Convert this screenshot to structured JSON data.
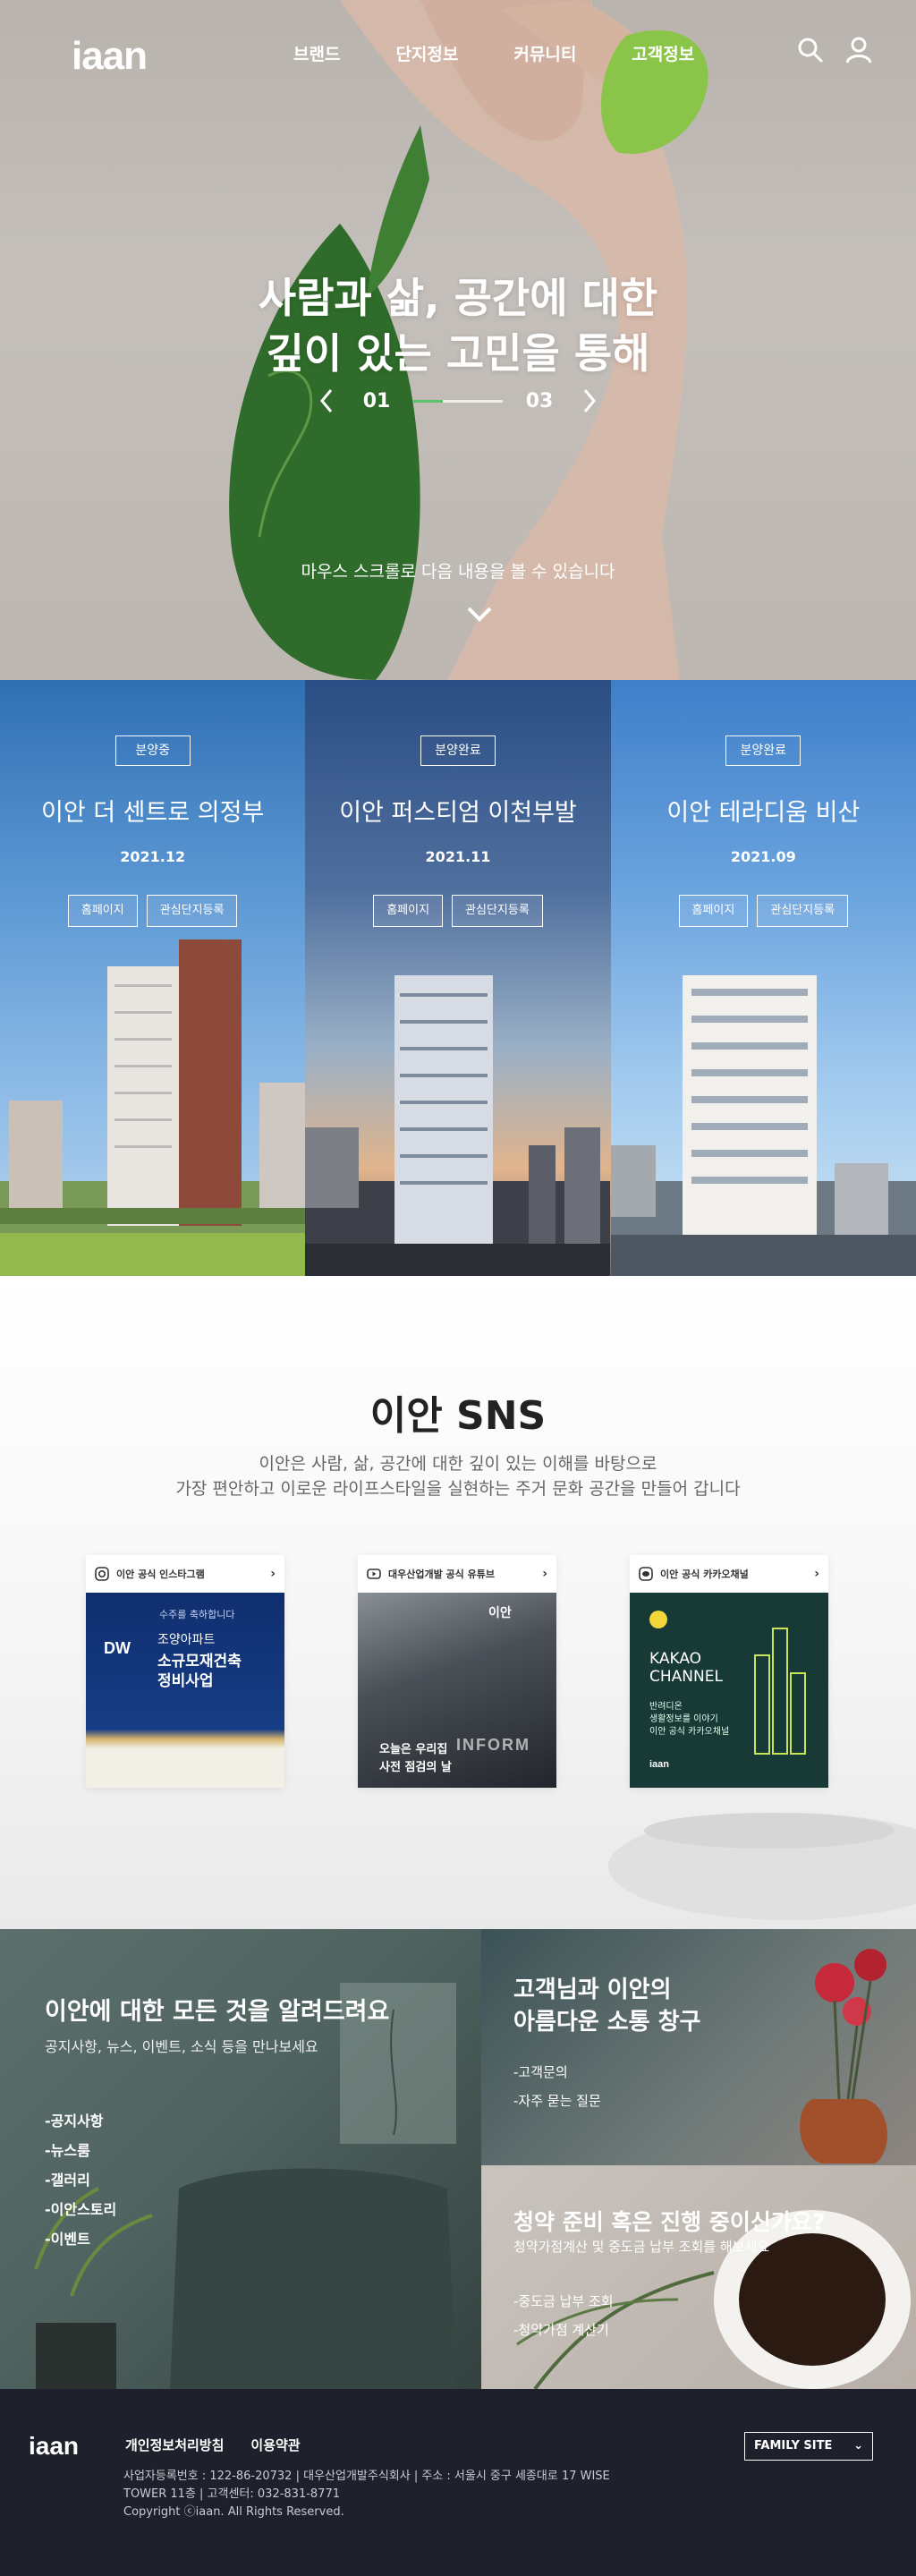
{
  "header": {
    "logo": "iaan",
    "nav": [
      "브랜드",
      "단지정보",
      "커뮤니티",
      "고객정보"
    ],
    "icons": [
      "search-icon",
      "user-icon"
    ]
  },
  "hero": {
    "title_line1_bold": "사람과 삶, 공간",
    "title_line1_rest": "에 대한",
    "title_line2": "깊이 있는 고민을 통해",
    "slide_current": "01",
    "slide_total": "03",
    "slide_progress": 0.33,
    "scroll_hint": "마우스 스크롤로 다음 내용을 볼 수 있습니다",
    "colors": {
      "progress": "#5bc26a"
    }
  },
  "projects": [
    {
      "status": "분양중",
      "name": "이안 더 센트로 의정부",
      "date": "2021.12",
      "btn_home": "홈페이지",
      "btn_register": "관심단지등록"
    },
    {
      "status": "분양완료",
      "name": "이안 퍼스티엄 이천부발",
      "date": "2021.11",
      "btn_home": "홈페이지",
      "btn_register": "관심단지등록"
    },
    {
      "status": "분양완료",
      "name": "이안 테라디움 비산",
      "date": "2021.09",
      "btn_home": "홈페이지",
      "btn_register": "관심단지등록"
    }
  ],
  "sns": {
    "title": "이안 SNS",
    "desc_line1": "이안은 사람, 삶, 공간에 대한 깊이 있는 이해를 바탕으로",
    "desc_line2": "가장 편안하고 이로운 라이프스타일을 실현하는 주거 문화 공간을 만들어 갑니다",
    "cards": [
      {
        "label": "이안 공식 인스타그램",
        "icon": "instagram-icon",
        "p1": "수주를 축하합니다",
        "p2": "조양아파트",
        "p3": "소규모재건축",
        "p4": "정비사업",
        "logo": "DW"
      },
      {
        "label": "대우산업개발 공식 유튜브",
        "icon": "youtube-icon",
        "p1": "이안",
        "p2": "오늘은 우리집",
        "p3": "사전 점검의 날",
        "p4": "INFORM"
      },
      {
        "label": "이안 공식 카카오채널",
        "icon": "kakao-icon",
        "p1": "KAKAO",
        "p2": "CHANNEL",
        "p3": "반려디온",
        "p4": "생활정보를 이야기",
        "p5": "이안 공식 카카오채널",
        "logo": "iaan"
      }
    ]
  },
  "info": {
    "left_title": "이안에 대한 모든 것을 알려드려요",
    "left_sub": "공지사항, 뉴스, 이벤트, 소식 등을 만나보세요",
    "left_links": [
      "-공지사항",
      "-뉴스룸",
      "-갤러리",
      "-이안스토리",
      "-이벤트"
    ],
    "r1_title_1": "고객님과 이안의",
    "r1_title_2": "아름다운 소통 창구",
    "r1_links": [
      "-고객문의",
      "-자주 묻는 질문"
    ],
    "r2_title": "청약 준비 혹은 진행 중이신가요?",
    "r2_sub": "청약가점계산 및 중도금 납부 조회를 해보세요",
    "r2_links": [
      "-중도금 납부 조회",
      "-청약가점 계산기"
    ]
  },
  "footer": {
    "logo": "iaan",
    "links": [
      "개인정보처리방침",
      "이용약관"
    ],
    "line1": "사업자등록번호 : 122-86-20732  |  대우산업개발주식회사  |  주소 : 서울시 중구 세종대로 17 WISE",
    "line2": "TOWER 11층  |  고객센터: 032-831-8771",
    "line3": "Copyright ⓒiaan. All Rights Reserved.",
    "family_site": "FAMILY SITE"
  }
}
